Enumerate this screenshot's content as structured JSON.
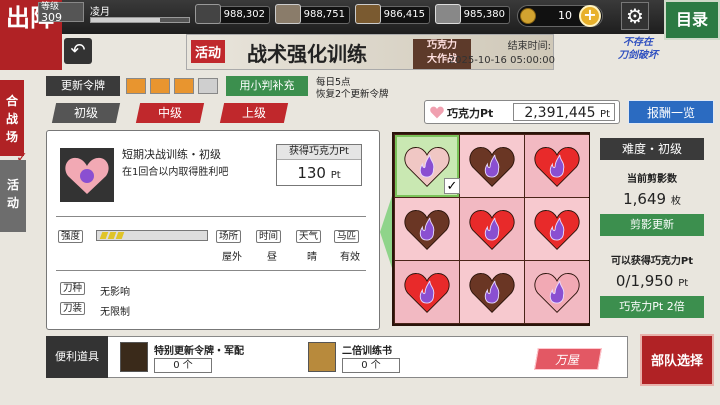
{
  "colors": {
    "accent_red": "#b02225",
    "green": "#3c8f4e",
    "blue": "#2b6bc1",
    "pink": "#e35864",
    "grid_bg": "#4a2418"
  },
  "topbar": {
    "sortie_title": "出阵",
    "level_label": "等级",
    "level": "309",
    "player_name": "凌月",
    "resources": [
      {
        "icon": "charcoal-icon",
        "value": "988,302"
      },
      {
        "icon": "tamahagane-icon",
        "value": "988,751"
      },
      {
        "icon": "cooling-material-icon",
        "value": "986,415"
      },
      {
        "icon": "whetstone-icon",
        "value": "985,380"
      }
    ],
    "coins": "10",
    "menu_label": "目录"
  },
  "banner": {
    "tag": "活动",
    "title": "战术强化训练",
    "chocolate_line1": "巧克力",
    "chocolate_line2": "大作战",
    "end_label": "结束时间:",
    "end_time": "2025-10-16 05:00:00"
  },
  "logo": {
    "line1": "不存在",
    "line2": "刀剑破坏"
  },
  "side_tabs": {
    "coliseum": "合战场",
    "event": "活动"
  },
  "refresh": {
    "label": "更新令牌",
    "tokens": [
      true,
      true,
      true,
      false
    ],
    "add_label": "用小判补充",
    "note1": "每日5点",
    "note2": "恢复2个更新令牌"
  },
  "difficulty_tabs": [
    "初级",
    "中级",
    "上级"
  ],
  "points": {
    "label": "巧克力Pt",
    "value": "2,391,445",
    "unit": "Pt",
    "reward_btn": "报酬一览"
  },
  "mission": {
    "name": "短期决战训练・初级",
    "desc": "在1回合以内取得胜利吧",
    "get_label": "获得巧克力Pt",
    "get_value": "130",
    "get_unit": "Pt",
    "strength_label": "强度",
    "strength_level": 3,
    "strength_max": 10,
    "conditions": [
      {
        "label": "场所",
        "value": "屋外"
      },
      {
        "label": "时间",
        "value": "昼"
      },
      {
        "label": "天气",
        "value": "晴"
      },
      {
        "label": "马匹",
        "value": "有效"
      }
    ],
    "sword_type_label": "刀种",
    "sword_type_value": "无影响",
    "equip_label": "刀装",
    "equip_value": "无限制"
  },
  "grid": {
    "cells": [
      {
        "type": "selected",
        "fill": "#f0c7c4"
      },
      {
        "type": "brown",
        "fill": "#6a3624"
      },
      {
        "type": "red",
        "fill": "#e82a2a"
      },
      {
        "type": "brown",
        "fill": "#6a3624"
      },
      {
        "type": "red",
        "fill": "#e82a2a"
      },
      {
        "type": "red",
        "fill": "#e82a2a"
      },
      {
        "type": "red",
        "fill": "#e82a2a"
      },
      {
        "type": "brown",
        "fill": "#6a3624"
      },
      {
        "type": "pink",
        "fill": "#f2a9b4"
      }
    ],
    "cell_bg": [
      "#c9e8b2",
      "#f7c9cf",
      "#f2b9c2",
      "#f7c9cf",
      "#f2b9c2",
      "#f7c9cf",
      "#f2b9c2",
      "#f7c9cf",
      "#f2b9c2"
    ]
  },
  "stats": {
    "difficulty_label": "难度・初级",
    "cut_count_label": "当前剪影数",
    "cut_count": "1,649",
    "cut_unit": "枚",
    "refresh_btn": "剪影更新",
    "obtainable_label": "可以获得巧克力Pt",
    "obtainable_value": "0/1,950",
    "obtainable_unit": "Pt",
    "double_btn": "巧克力Pt 2倍"
  },
  "bottom": {
    "label": "便利道具",
    "item1_name": "特别更新令牌・军配",
    "item1_count": "0",
    "item1_unit": "个",
    "item2_name": "二倍训练书",
    "item2_count": "0",
    "item2_unit": "个",
    "shop_btn": "万屋",
    "team_btn": "部队选择"
  }
}
